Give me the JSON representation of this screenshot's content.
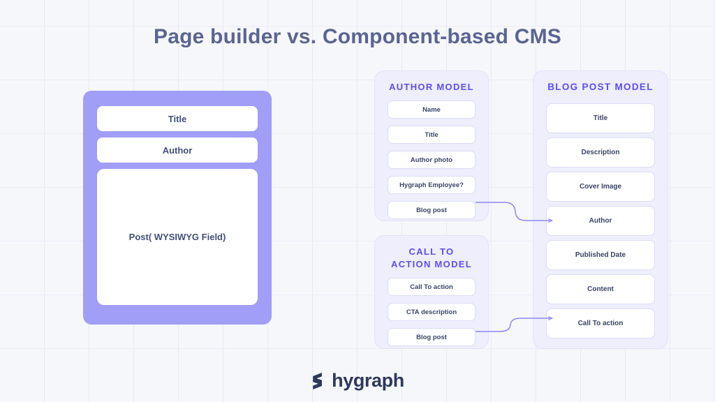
{
  "page": {
    "title": "Page builder vs. Component-based CMS",
    "background_color": "#f6f7fa",
    "grid_line_color": "#e9e9f8"
  },
  "colors": {
    "title_text": "#5a6591",
    "model_heading": "#5b4ef0",
    "builder_card": "#a09ef6",
    "model_card_bg": "#eeeefc",
    "field_text": "#3a4466",
    "connector": "#8e86f0",
    "logo": "#2e3a5c"
  },
  "page_builder": {
    "name": "page-builder-card",
    "fields": [
      {
        "label": "Title",
        "size": "small"
      },
      {
        "label": "Author",
        "size": "small"
      },
      {
        "label": "Post( WYSIWYG Field)",
        "size": "big"
      }
    ]
  },
  "models": [
    {
      "id": "author-model",
      "title": "AUTHOR MODEL",
      "fields": [
        {
          "label": "Name"
        },
        {
          "label": "Title"
        },
        {
          "label": "Author photo"
        },
        {
          "label": "Hygraph Employee?"
        },
        {
          "label": "Blog post"
        }
      ]
    },
    {
      "id": "call-to-action-model",
      "title": "CALL TO ACTION MODEL",
      "fields": [
        {
          "label": "Call To action"
        },
        {
          "label": "CTA description"
        },
        {
          "label": "Blog post"
        }
      ]
    },
    {
      "id": "blog-post-model",
      "title": "BLOG POST MODEL",
      "fields": [
        {
          "label": "Title"
        },
        {
          "label": "Description"
        },
        {
          "label": "Cover Image"
        },
        {
          "label": "Author"
        },
        {
          "label": "Published Date"
        },
        {
          "label": "Content"
        },
        {
          "label": "Call To action"
        }
      ]
    }
  ],
  "connections": [
    {
      "from": "author-model.Blog post",
      "to": "blog-post-model.Author"
    },
    {
      "from": "call-to-action-model.Blog post",
      "to": "blog-post-model.Call To action"
    }
  ],
  "logo": {
    "mark": "hygraph-mark-icon",
    "wordmark": "hygraph"
  }
}
